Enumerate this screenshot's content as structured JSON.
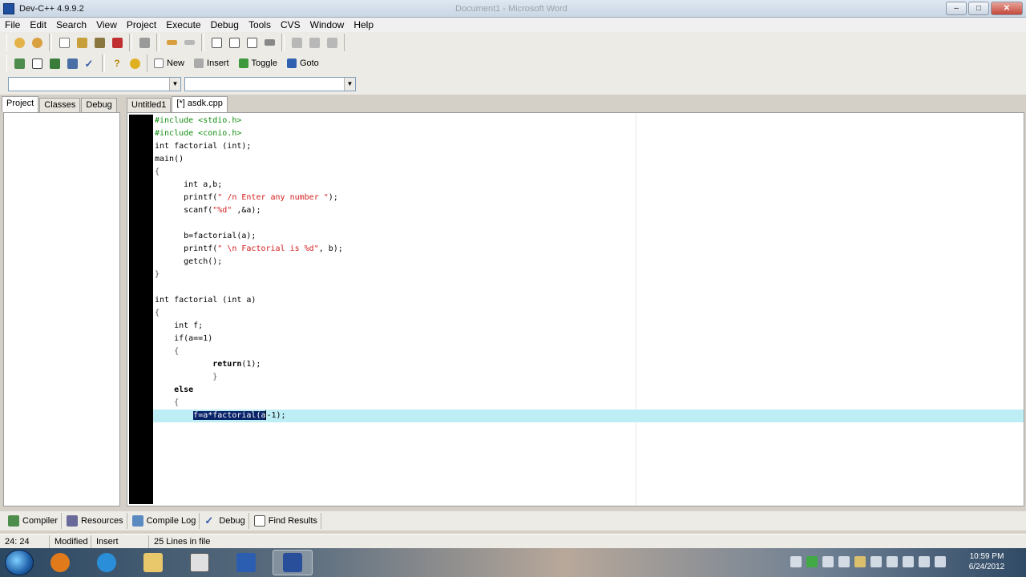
{
  "window": {
    "title": "Dev-C++ 4.9.9.2",
    "background_title": "Document1 - Microsoft Word"
  },
  "window_buttons": {
    "minimize": "–",
    "maximize": "□",
    "close": "✕"
  },
  "menu": [
    "File",
    "Edit",
    "Search",
    "View",
    "Project",
    "Execute",
    "Debug",
    "Tools",
    "CVS",
    "Window",
    "Help"
  ],
  "toolbar2": {
    "new_label": "New",
    "insert_label": "Insert",
    "toggle_label": "Toggle",
    "goto_label": "Goto"
  },
  "left_tabs": [
    "Project",
    "Classes",
    "Debug"
  ],
  "editor_tabs": [
    "Untitled1",
    "[*] asdk.cpp"
  ],
  "code_lines": [
    [
      {
        "t": "#include <stdio.h>",
        "c": "pp"
      }
    ],
    [
      {
        "t": "#include <conio.h>",
        "c": "pp"
      }
    ],
    [
      {
        "t": "int factorial (int);",
        "c": ""
      }
    ],
    [
      {
        "t": "main()",
        "c": ""
      }
    ],
    [
      {
        "t": "{",
        "c": "sym"
      }
    ],
    [
      {
        "t": "      int a,b;",
        "c": ""
      }
    ],
    [
      {
        "t": "      printf(",
        "c": ""
      },
      {
        "t": "\" /n Enter any number \"",
        "c": "str"
      },
      {
        "t": ");",
        "c": ""
      }
    ],
    [
      {
        "t": "      scanf(",
        "c": ""
      },
      {
        "t": "\"%d\"",
        "c": "str"
      },
      {
        "t": " ,&a);",
        "c": ""
      }
    ],
    [
      {
        "t": "",
        "c": ""
      }
    ],
    [
      {
        "t": "      b=factorial(a);",
        "c": ""
      }
    ],
    [
      {
        "t": "      printf(",
        "c": ""
      },
      {
        "t": "\" \\n Factorial is %d\"",
        "c": "str"
      },
      {
        "t": ", b);",
        "c": ""
      }
    ],
    [
      {
        "t": "      getch();",
        "c": ""
      }
    ],
    [
      {
        "t": "}",
        "c": "sym"
      }
    ],
    [
      {
        "t": "",
        "c": ""
      }
    ],
    [
      {
        "t": "int factorial (int a)",
        "c": ""
      }
    ],
    [
      {
        "t": "{",
        "c": "sym"
      }
    ],
    [
      {
        "t": "    int f;",
        "c": ""
      }
    ],
    [
      {
        "t": "    if(a==1)",
        "c": ""
      }
    ],
    [
      {
        "t": "    {",
        "c": "sym"
      }
    ],
    [
      {
        "t": "            ",
        "c": ""
      },
      {
        "t": "return",
        "c": "kw"
      },
      {
        "t": "(1);",
        "c": ""
      }
    ],
    [
      {
        "t": "            }",
        "c": "sym"
      }
    ],
    [
      {
        "t": "    ",
        "c": ""
      },
      {
        "t": "else",
        "c": "kw"
      }
    ],
    [
      {
        "t": "    {",
        "c": "sym"
      }
    ],
    [
      {
        "t": "        ",
        "c": ""
      },
      {
        "t": "f=a*factorial(a",
        "c": "sel"
      },
      {
        "t": "-1);",
        "c": ""
      }
    ]
  ],
  "report_tabs": [
    "Compiler",
    "Resources",
    "Compile Log",
    "Debug",
    "Find Results"
  ],
  "status": {
    "position": "24: 24",
    "modified": "Modified",
    "mode": "Insert",
    "lines": "25 Lines in file"
  },
  "clock": {
    "time": "10:59 PM",
    "date": "6/24/2012"
  },
  "colors": {
    "highlight_line": "#bdeef6",
    "selection": "#0a246a",
    "preprocessor": "#138e13",
    "string": "#d22020"
  }
}
